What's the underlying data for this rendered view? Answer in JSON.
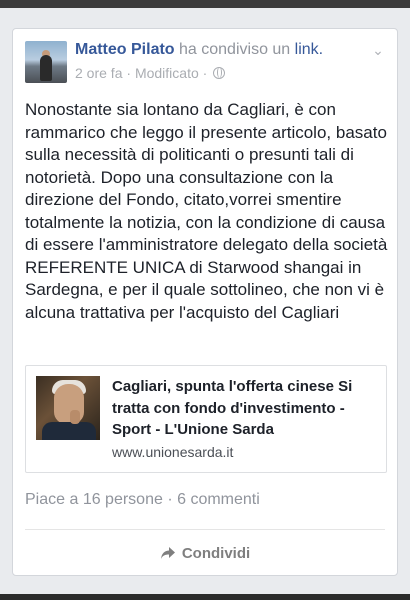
{
  "post": {
    "author": "Matteo Pilato",
    "action": "ha condiviso un",
    "object": "link.",
    "time": "2 ore fa",
    "separator": "·",
    "edited": "Modificato",
    "text": "Nonostante sia lontano da Cagliari, è con rammarico che leggo il presente articolo, basato sulla necessità di politicanti o presunti tali di notorietà. Dopo una consultazione con la direzione del Fondo, citato,vorrei smentire totalmente la notizia, con la condizione di causa di essere l'amministratore delegato della società REFERENTE UNICA di Starwood shangai in Sardegna, e per il quale sottolineo, che non vi è alcuna trattativa per l'acquisto del Cagliari"
  },
  "link_preview": {
    "title": "Cagliari, spunta l'offerta cinese Si tratta con fondo d'investimento - Sport - L'Unione Sarda",
    "domain": "www.unionesarda.it"
  },
  "stats": {
    "text": "Piace a 16 persone · 6 commenti"
  },
  "actions": {
    "share_label": "Condividi"
  },
  "icons": {
    "menu": "chevron-down-icon",
    "privacy": "globe-icon",
    "share": "share-arrow-icon"
  },
  "colors": {
    "link_blue": "#365899",
    "text": "#1d2129",
    "muted": "#90949c"
  }
}
